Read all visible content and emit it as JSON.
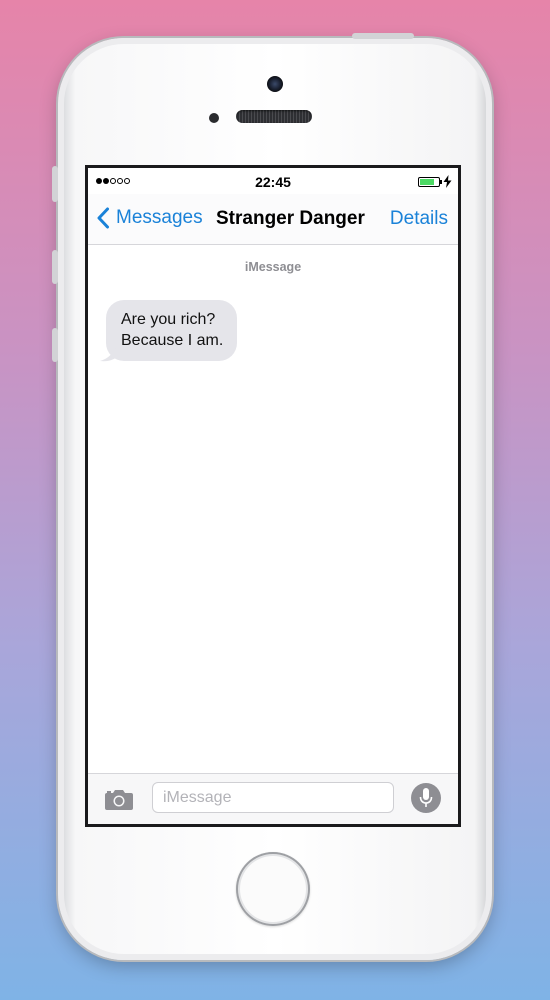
{
  "status_bar": {
    "time": "22:45",
    "signal_bars": [
      true,
      true,
      false,
      false,
      false
    ],
    "battery_level": 0.75,
    "charging": true
  },
  "nav": {
    "back_label": "Messages",
    "title": "Stranger Danger",
    "details_label": "Details"
  },
  "conversation": {
    "service_label": "iMessage",
    "messages": [
      {
        "direction": "incoming",
        "lines": [
          "Are you rich?",
          "Because I am."
        ]
      }
    ]
  },
  "input": {
    "placeholder": "iMessage",
    "value": ""
  },
  "colors": {
    "accent": "#1a82d8",
    "incoming_bubble": "#e5e5ea",
    "battery_fill": "#4cd964"
  },
  "icons": {
    "back": "chevron-left-icon",
    "camera": "camera-icon",
    "mic": "microphone-icon",
    "charging": "lightning-bolt-icon"
  }
}
